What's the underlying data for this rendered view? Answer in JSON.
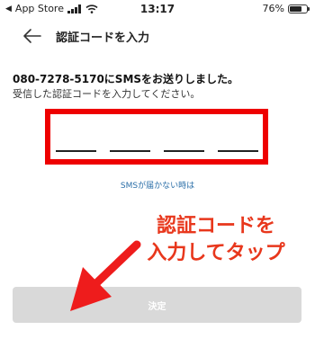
{
  "status_bar": {
    "carrier": "App Store",
    "time": "13:17",
    "battery": "76%",
    "battery_level": 0.76
  },
  "header": {
    "title": "認証コードを入力"
  },
  "message": {
    "main": "080-7278-5170にSMSをお送りしました。",
    "sub": "受信した認証コードを入力してください。"
  },
  "code_input": {
    "slots": [
      "",
      "",
      "",
      ""
    ]
  },
  "sms_link": "SMSが届かない時は",
  "annotation": {
    "line1": "認証コードを",
    "line2": "入力してタップ",
    "color": "#e8371c"
  },
  "submit_label": "決定",
  "colors": {
    "highlight": "#ee0000",
    "link": "#2b6fa8",
    "button_disabled": "#d9d9d9"
  }
}
